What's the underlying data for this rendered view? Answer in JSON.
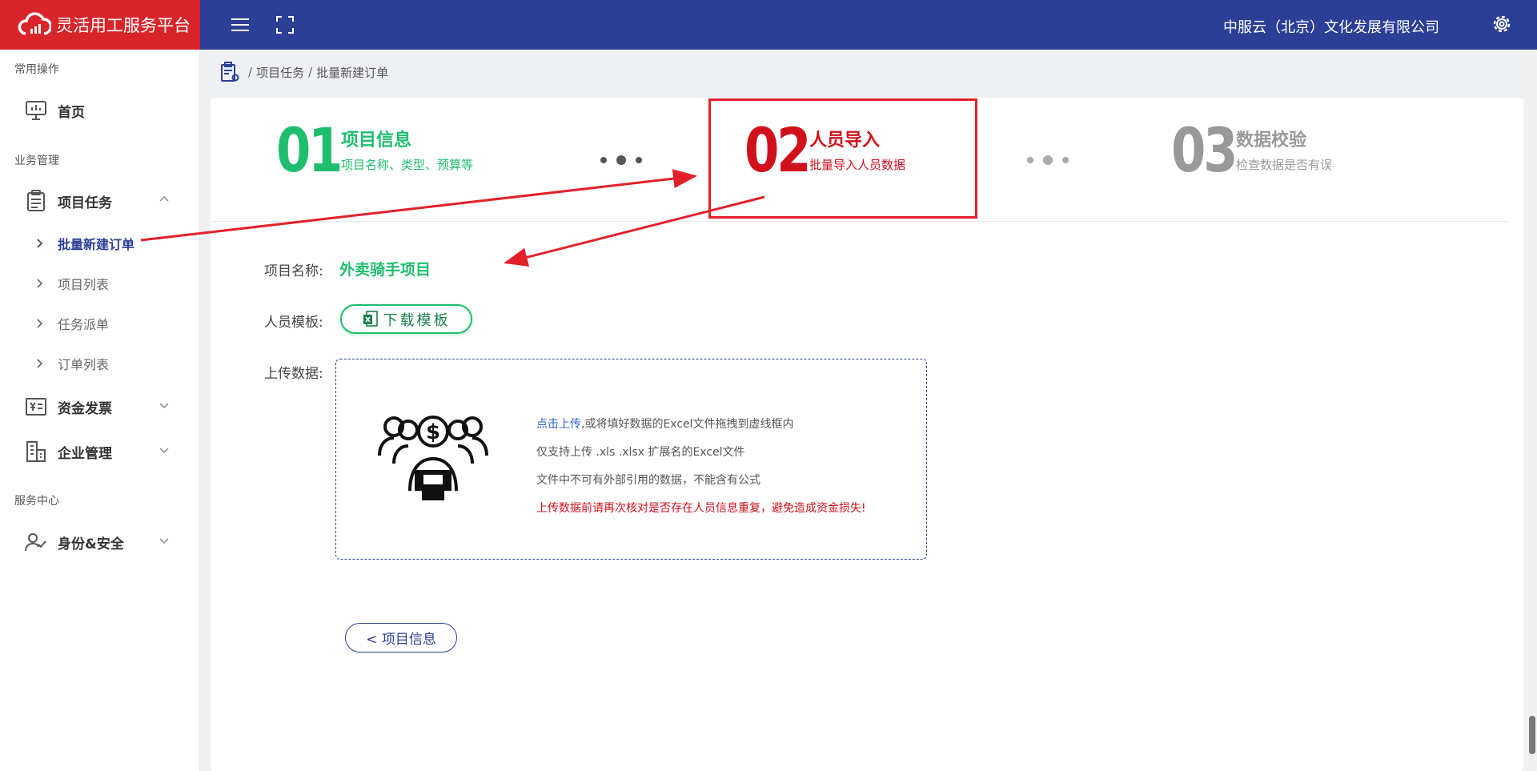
{
  "header": {
    "brand_title": "灵活用工服务平台",
    "company": "中服云（北京）文化发展有限公司",
    "brand_color": "#d9252a",
    "bar_color": "#2c3f96",
    "icons": [
      "menu-icon",
      "fullscreen-icon",
      "settings-icon"
    ]
  },
  "sidebar": {
    "groups": {
      "common": "常用操作",
      "business": "业务管理",
      "service": "服务中心"
    },
    "items": {
      "home": "首页",
      "project_tasks": "项目任务",
      "funds_invoice": "资金发票",
      "enterprise": "企业管理",
      "identity_security": "身份&安全"
    },
    "sub_items": {
      "batch_order": "批量新建订单",
      "project_list": "项目列表",
      "task_dispatch": "任务派单",
      "order_list": "订单列表"
    },
    "active": "批量新建订单"
  },
  "breadcrumb": {
    "sep": "/",
    "level1": "项目任务",
    "level2": "批量新建订单"
  },
  "steps": [
    {
      "num": "01",
      "title": "项目信息",
      "sub": "项目名称、类型、预算等",
      "color": "#1fbe6e"
    },
    {
      "num": "02",
      "title": "人员导入",
      "sub": "批量导入人员数据",
      "color": "#d0101b"
    },
    {
      "num": "03",
      "title": "数据校验",
      "sub": "检查数据是否有误",
      "color": "#999999"
    }
  ],
  "form": {
    "project_label": "项目名称:",
    "project_value": "外卖骑手项目",
    "template_label": "人员模板:",
    "download_button": "下载模板",
    "upload_label": "上传数据:",
    "upload_link": "点击上传",
    "upload_hint1_rest": ",或将填好数据的Excel文件拖拽到虚线框内",
    "upload_hint2": "仅支持上传 .xls .xlsx 扩展名的Excel文件",
    "upload_hint3": "文件中不可有外部引用的数据，不能含有公式",
    "upload_warning": "上传数据前请再次核对是否存在人员信息重复，避免造成资金损失!"
  },
  "back_button": "< 项目信息"
}
